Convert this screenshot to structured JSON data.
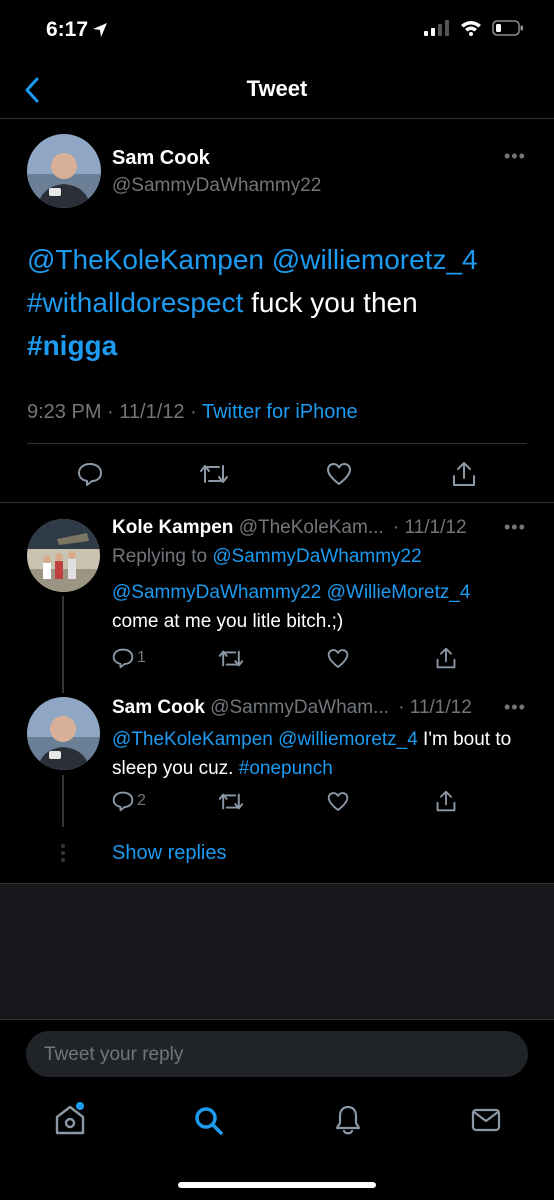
{
  "status_bar": {
    "time": "6:17"
  },
  "nav": {
    "title": "Tweet"
  },
  "main_tweet": {
    "name": "Sam Cook",
    "handle": "@SammyDaWhammy22",
    "mention1": "@TheKoleKampen",
    "mention2": "@williemoretz_4",
    "hashtag1": "#withalldorespect",
    "text_plain": " fuck you then",
    "hashtag2": "#nigga",
    "time": "9:23 PM",
    "date": "11/1/12",
    "source": "Twitter for iPhone",
    "sep": "·"
  },
  "replies": [
    {
      "name": "Kole Kampen",
      "handle": "@TheKoleKam...",
      "date": "· 11/1/12",
      "replying_prefix": "Replying to ",
      "replying_to": "@SammyDaWhammy22",
      "mention1": "@SammyDaWhammy22",
      "mention2": "@WillieMoretz_4",
      "text": "come at me you litle bitch.;)",
      "reply_count": "1"
    },
    {
      "name": "Sam Cook",
      "handle": "@SammyDaWham...",
      "date": "· 11/1/12",
      "mention1": "@TheKoleKampen",
      "mention2": "@williemoretz_4",
      "text_plain": " I'm bout to sleep you cuz. ",
      "hashtag": "#onepunch",
      "reply_count": "2"
    }
  ],
  "show_replies": "Show replies",
  "compose": {
    "placeholder": "Tweet your reply"
  },
  "tab_bar": {
    "items": [
      "home-icon",
      "search-icon",
      "notifications-icon",
      "messages-icon"
    ]
  },
  "colors": {
    "accent": "#1d9bf0",
    "background": "#000000",
    "muted": "#71767b"
  }
}
